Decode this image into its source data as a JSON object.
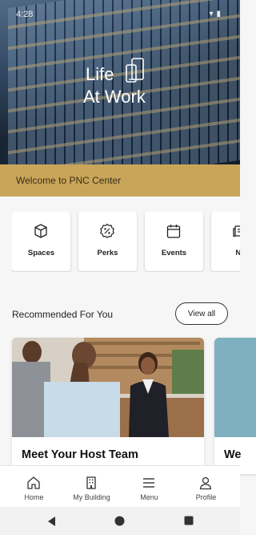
{
  "status_bar": {
    "time": "4:28"
  },
  "hero": {
    "logo_line1": "Life",
    "logo_line2": "At Work"
  },
  "welcome": {
    "text": "Welcome to PNC Center"
  },
  "quick_links": [
    {
      "label": "Spaces",
      "icon": "cube-icon"
    },
    {
      "label": "Perks",
      "icon": "percent-badge-icon"
    },
    {
      "label": "Events",
      "icon": "calendar-icon"
    },
    {
      "label": "Ne",
      "icon": "news-icon"
    }
  ],
  "recommended": {
    "title": "Recommended For You",
    "view_all": "View all",
    "cards": [
      {
        "title": "Meet Your Host Team"
      },
      {
        "title": "We"
      }
    ]
  },
  "bottom_nav": [
    {
      "label": "Home",
      "icon": "home-icon"
    },
    {
      "label": "My Building",
      "icon": "building-icon"
    },
    {
      "label": "Menu",
      "icon": "menu-icon"
    },
    {
      "label": "Profile",
      "icon": "profile-icon"
    }
  ],
  "colors": {
    "accent": "#c9a55a",
    "background": "#f6f6f6"
  }
}
